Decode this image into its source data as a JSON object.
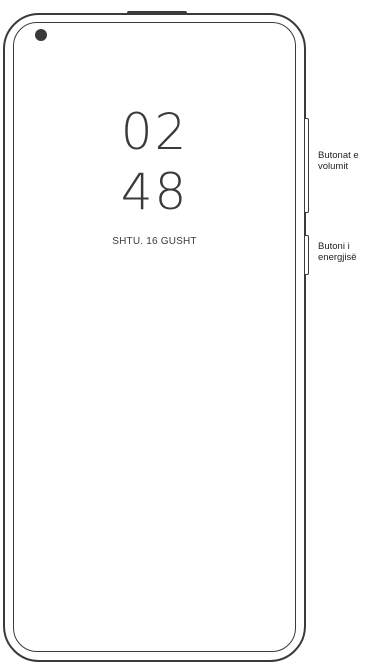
{
  "lockscreen": {
    "hours": "02",
    "minutes": "48",
    "date": "SHTU. 16 GUSHT"
  },
  "callouts": {
    "volume_label": "Butonat e\nvolumit",
    "power_label": "Butoni i\nenergjisë"
  },
  "colors": {
    "outline": "#3a3a3a",
    "background": "#ffffff"
  }
}
